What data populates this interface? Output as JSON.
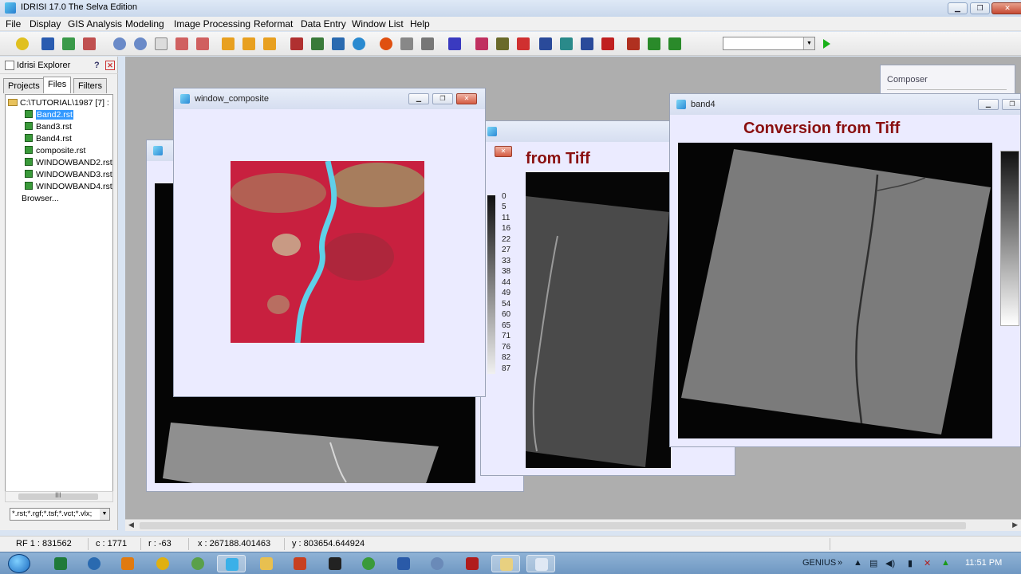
{
  "window": {
    "title": "IDRISI 17.0    The Selva Edition"
  },
  "menu": [
    "File",
    "Display",
    "GIS Analysis",
    "Modeling",
    "Image Processing",
    "Reformat",
    "Data Entry",
    "Window List",
    "Help"
  ],
  "explorer": {
    "title": "Idrisi Explorer",
    "tabs": [
      "Projects",
      "Files",
      "Filters"
    ],
    "root": "C:\\TUTORIAL\\1987 [7] :",
    "files": [
      "Band2.rst",
      "Band3.rst",
      "Band4.rst",
      "composite.rst",
      "WINDOWBAND2.rst",
      "WINDOWBAND3.rst",
      "WINDOWBAND4.rst"
    ],
    "selected_file": "Band2.rst",
    "browser": "Browser...",
    "filter": "*.rst;*.rgf;*.tsf;*.vct;*.vlx;",
    "scroll_label": "III"
  },
  "windows": {
    "composite": {
      "title": "window_composite"
    },
    "back": {
      "heading": "from Tiff",
      "legend": [
        "0",
        "5",
        "11",
        "16",
        "22",
        "27",
        "33",
        "38",
        "44",
        "49",
        "54",
        "60",
        "65",
        "71",
        "76",
        "82",
        "87"
      ]
    },
    "band4": {
      "title": "band4",
      "heading": "Conversion from Tiff"
    },
    "composer": {
      "title": "Composer"
    }
  },
  "status": {
    "rf": "RF 1 : 831562",
    "c": "c : 1771",
    "r": "r : -63",
    "x": "x : 267188.401463",
    "y": "y : 803654.644924"
  },
  "taskbar": {
    "tray_label": "GENIUS",
    "time": "11:51 PM"
  },
  "colors": {
    "heading": "#8a1010",
    "selection": "#3399ff",
    "workspace": "#aeaeae",
    "window_bg": "#ebebff"
  }
}
